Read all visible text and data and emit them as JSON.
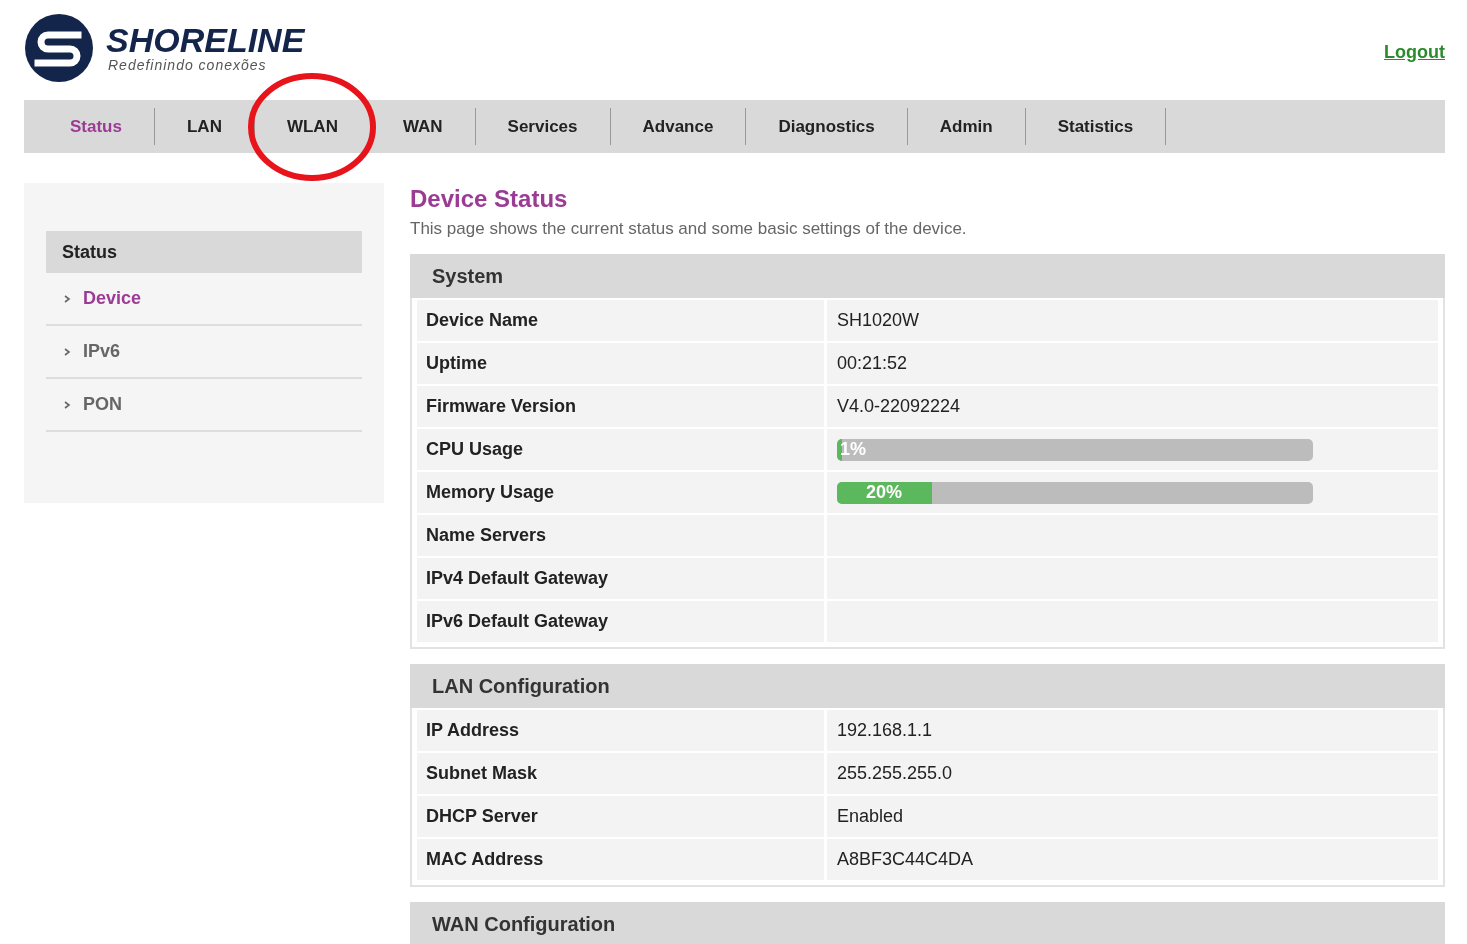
{
  "header": {
    "brand": "SHORELINE",
    "tagline": "Redefinindo conexões",
    "logout": "Logout"
  },
  "tabs": [
    {
      "label": "Status",
      "selected": true,
      "circled": false
    },
    {
      "label": "LAN",
      "selected": false,
      "circled": false
    },
    {
      "label": "WLAN",
      "selected": false,
      "circled": true
    },
    {
      "label": "WAN",
      "selected": false,
      "circled": false
    },
    {
      "label": "Services",
      "selected": false,
      "circled": false
    },
    {
      "label": "Advance",
      "selected": false,
      "circled": false
    },
    {
      "label": "Diagnostics",
      "selected": false,
      "circled": false
    },
    {
      "label": "Admin",
      "selected": false,
      "circled": false
    },
    {
      "label": "Statistics",
      "selected": false,
      "circled": false
    }
  ],
  "sidebar": {
    "title": "Status",
    "items": [
      {
        "label": "Device",
        "selected": true
      },
      {
        "label": "IPv6",
        "selected": false
      },
      {
        "label": "PON",
        "selected": false
      }
    ]
  },
  "page": {
    "title": "Device Status",
    "description": "This page shows the current status and some basic settings of the device."
  },
  "sections": [
    {
      "title": "System",
      "rows": [
        {
          "kind": "text",
          "label": "Device Name",
          "value": "SH1020W"
        },
        {
          "kind": "text",
          "label": "Uptime",
          "value": "00:21:52"
        },
        {
          "kind": "text",
          "label": "Firmware Version",
          "value": "V4.0-22092224"
        },
        {
          "kind": "meter",
          "label": "CPU Usage",
          "level": 0.01,
          "reading": "1%"
        },
        {
          "kind": "meter",
          "label": "Memory Usage",
          "level": 0.2,
          "reading": "20%"
        },
        {
          "kind": "text",
          "label": "Name Servers"
        },
        {
          "kind": "text",
          "label": "IPv4 Default Gateway"
        },
        {
          "kind": "text",
          "label": "IPv6 Default Gateway"
        }
      ]
    },
    {
      "title": "LAN Configuration",
      "rows": [
        {
          "kind": "text",
          "label": "IP Address",
          "value": "192.168.1.1"
        },
        {
          "kind": "text",
          "label": "Subnet Mask",
          "value": "255.255.255.0"
        },
        {
          "kind": "text",
          "label": "DHCP Server",
          "value": "Enabled"
        },
        {
          "kind": "text",
          "label": "MAC Address",
          "value": "A8BF3C44C4DA"
        }
      ]
    },
    {
      "title": "WAN Configuration"
    }
  ]
}
